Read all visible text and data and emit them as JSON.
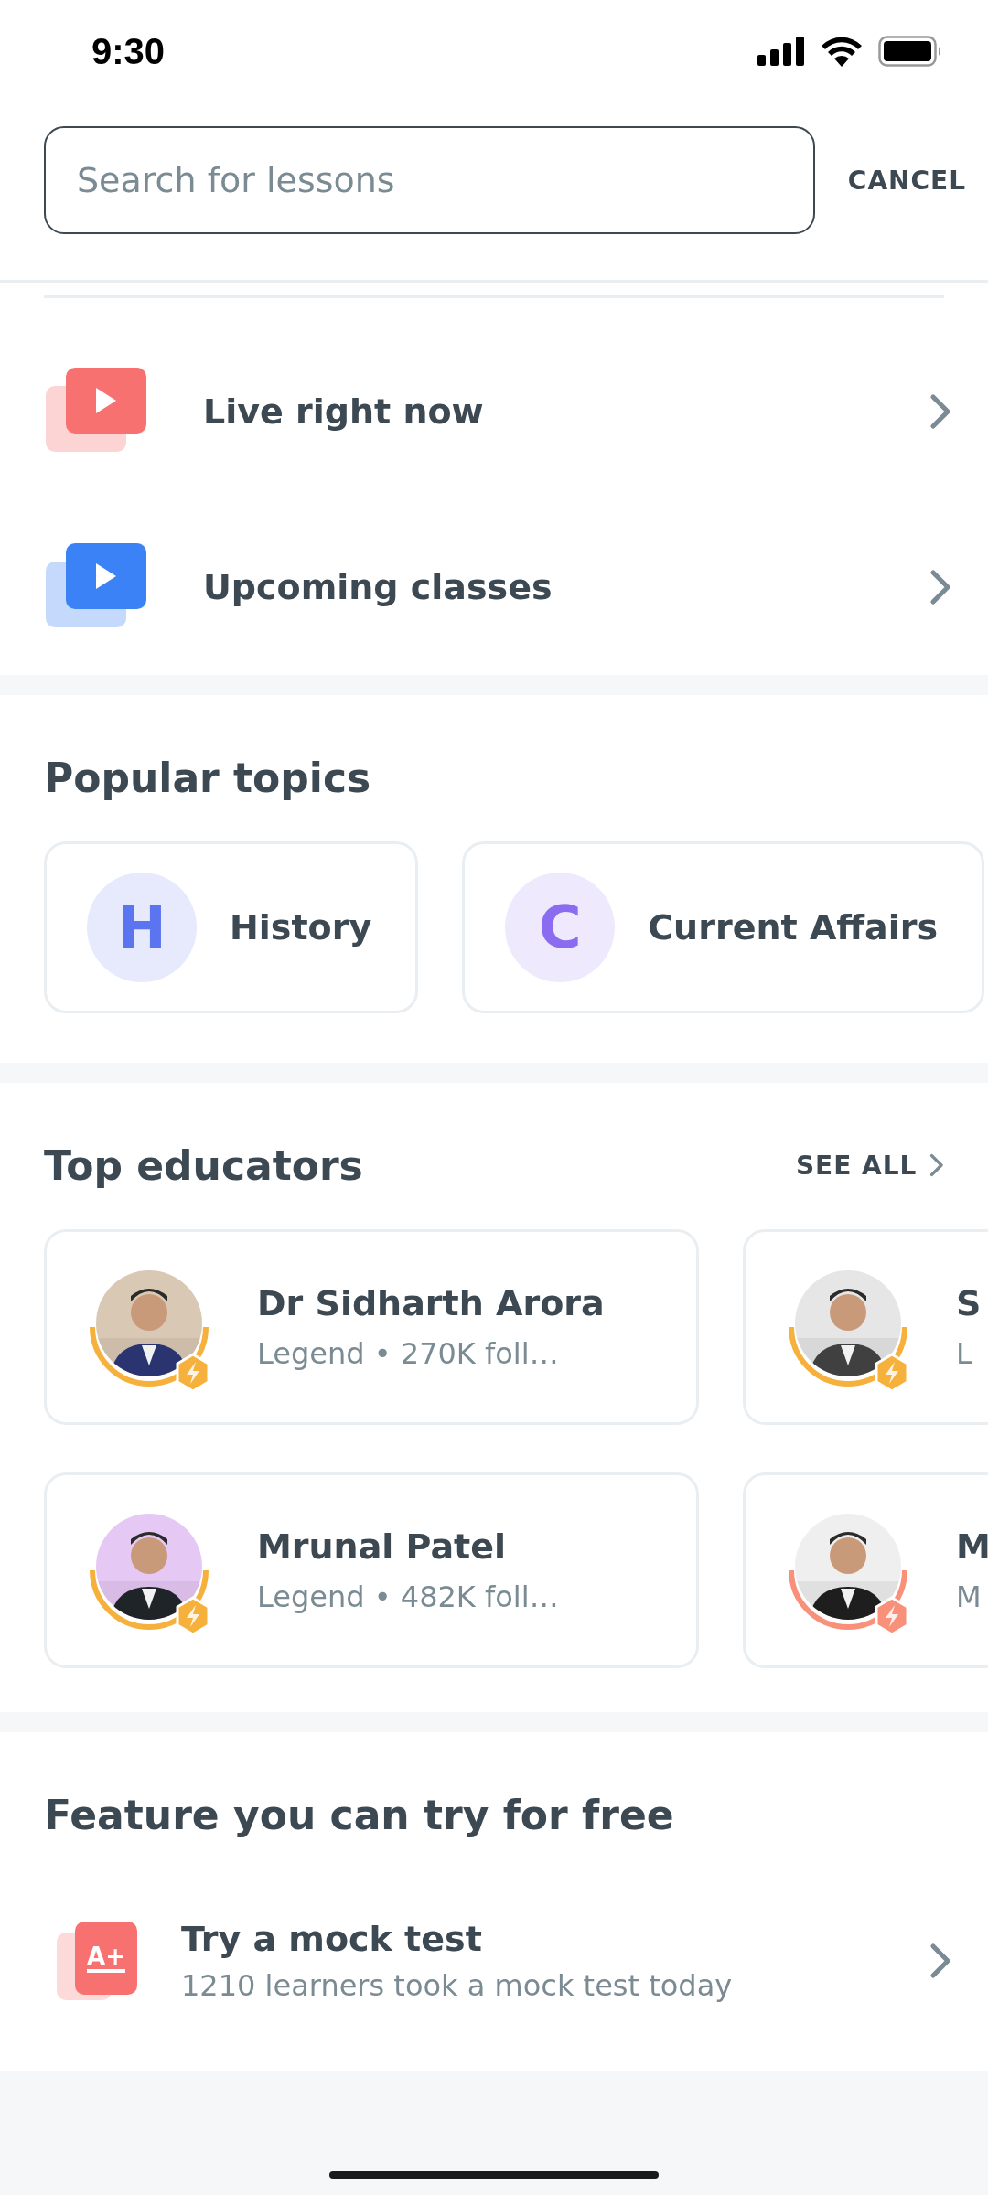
{
  "status_bar": {
    "time": "9:30"
  },
  "search": {
    "placeholder": "Search for lessons",
    "cancel": "CANCEL"
  },
  "quick_links": [
    {
      "label": "Live right now",
      "color": "#f87171"
    },
    {
      "label": "Upcoming classes",
      "color": "#3b82f6"
    }
  ],
  "popular_topics": {
    "title": "Popular topics",
    "items": [
      {
        "letter": "H",
        "label": "History",
        "color": "#5b74f0"
      },
      {
        "letter": "C",
        "label": "Current Affairs",
        "color": "#8b6cf0"
      }
    ]
  },
  "top_educators": {
    "title": "Top educators",
    "see_all": "SEE ALL",
    "rows": [
      {
        "educators": [
          {
            "name": "Dr Sidharth Arora",
            "meta": "Legend • 270K foll…",
            "color": "#f6b13c"
          },
          {
            "name": "S",
            "meta": "L",
            "color": "#f6b13c"
          }
        ]
      },
      {
        "educators": [
          {
            "name": "Mrunal Patel",
            "meta": "Legend • 482K foll…",
            "color": "#f6b13c"
          },
          {
            "name": "M",
            "meta": "M",
            "color": "#f9907a"
          }
        ]
      }
    ]
  },
  "features": {
    "title": "Feature you can try for free",
    "items": [
      {
        "icon_text": "A+",
        "title": "Try a mock test",
        "subtitle": "1210 learners took a mock test today"
      }
    ]
  }
}
